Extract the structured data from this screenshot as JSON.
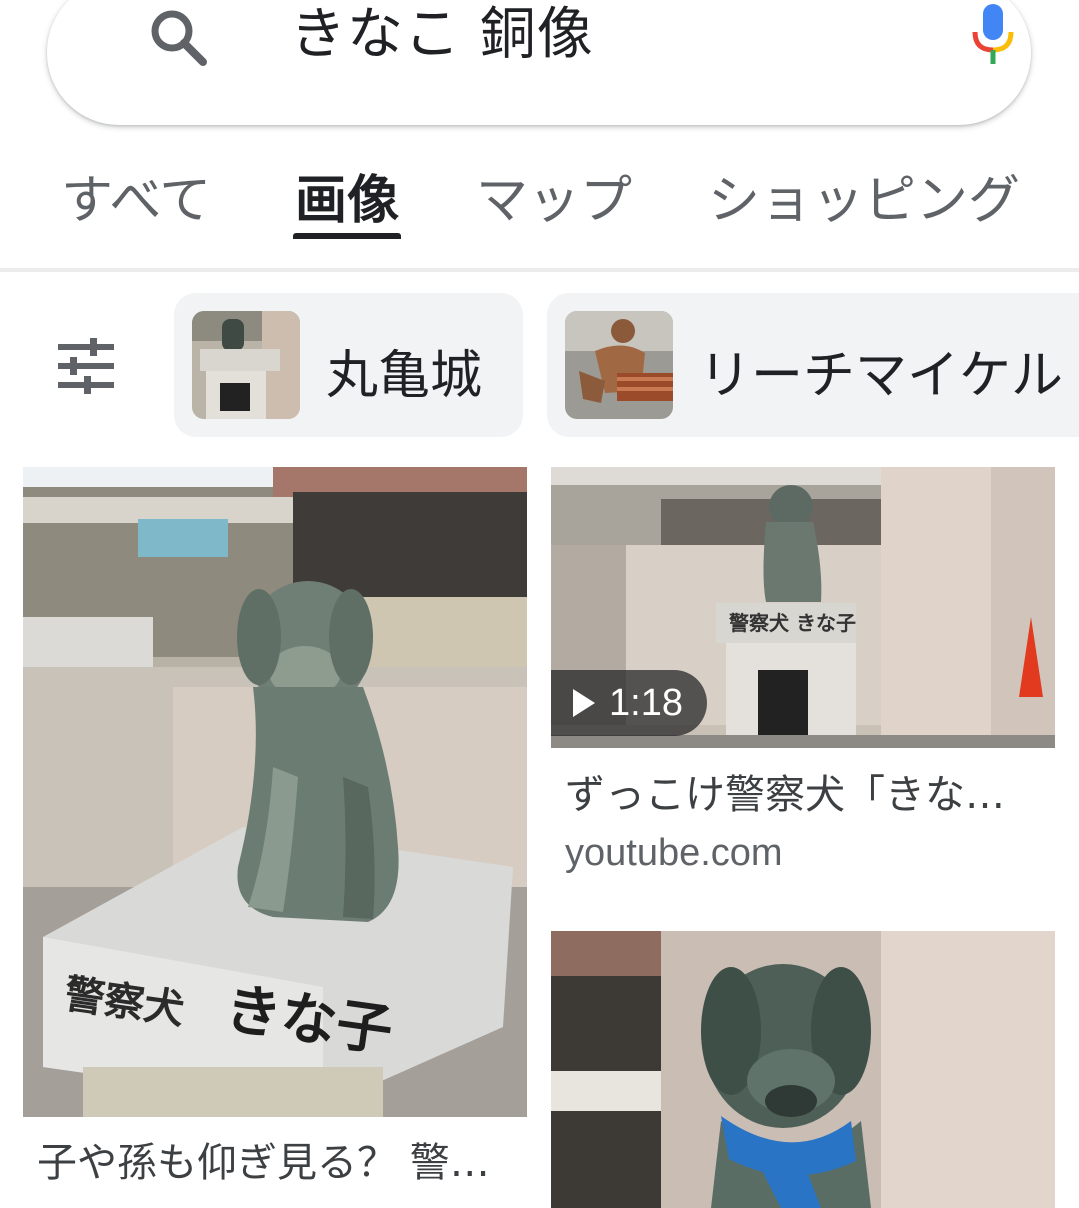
{
  "search": {
    "query": "きなこ 銅像"
  },
  "tabs": [
    {
      "label": "すべて"
    },
    {
      "label": "画像"
    },
    {
      "label": "マップ"
    },
    {
      "label": "ショッピング"
    }
  ],
  "chips": [
    {
      "label": "丸亀城"
    },
    {
      "label": "リーチマイケル"
    }
  ],
  "results": [
    {
      "title": "子や孫も仰ぎ見る？ 警…"
    },
    {
      "title": "ずっこけ警察犬「きな…",
      "source": "youtube.com",
      "duration": "1:18"
    },
    {
      "title": ""
    }
  ],
  "colors": {
    "mic_blue": "#4285F4",
    "mic_red": "#EA4335",
    "mic_yellow": "#FBBC05",
    "mic_green": "#34A853"
  }
}
